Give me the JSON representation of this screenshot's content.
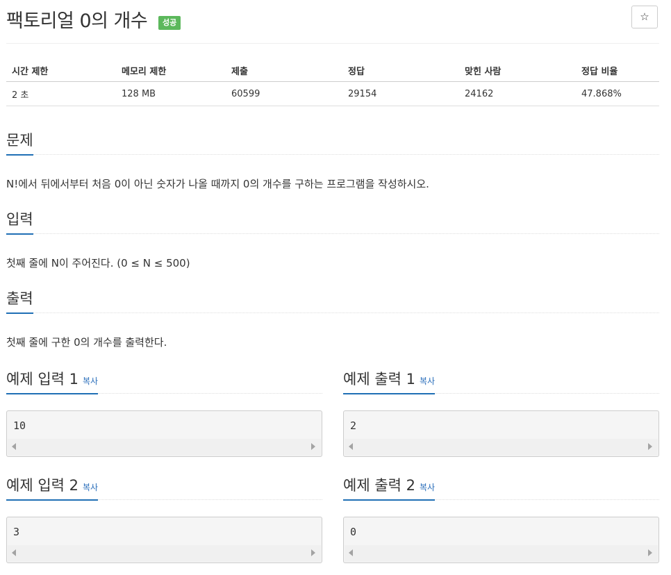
{
  "problem": {
    "title": "팩토리얼 0의 개수",
    "badge": "성공",
    "star": "☆"
  },
  "info_table": {
    "headers": [
      "시간 제한",
      "메모리 제한",
      "제출",
      "정답",
      "맞힌 사람",
      "정답 비율"
    ],
    "values": [
      "2 초",
      "128 MB",
      "60599",
      "29154",
      "24162",
      "47.868%"
    ]
  },
  "sections": {
    "description": {
      "heading": "문제",
      "text": "N!에서 뒤에서부터 처음 0이 아닌 숫자가 나올 때까지 0의 개수를 구하는 프로그램을 작성하시오."
    },
    "input": {
      "heading": "입력",
      "text": "첫째 줄에 N이 주어진다. (0 ≤ N ≤ 500)"
    },
    "output": {
      "heading": "출력",
      "text": "첫째 줄에 구한 0의 개수를 출력한다."
    }
  },
  "samples": [
    {
      "heading": "예제 입력 1",
      "copy": "복사",
      "value": "10"
    },
    {
      "heading": "예제 출력 1",
      "copy": "복사",
      "value": "2"
    },
    {
      "heading": "예제 입력 2",
      "copy": "복사",
      "value": "3"
    },
    {
      "heading": "예제 출력 2",
      "copy": "복사",
      "value": "0"
    }
  ],
  "colors": {
    "accent": "#1f6fb5",
    "badge_success": "#5cb85c",
    "link": "#2a6ebb"
  },
  "icons": {
    "star": "star-icon",
    "scroll_left": "scroll-left-arrow-icon",
    "scroll_right": "scroll-right-arrow-icon"
  }
}
